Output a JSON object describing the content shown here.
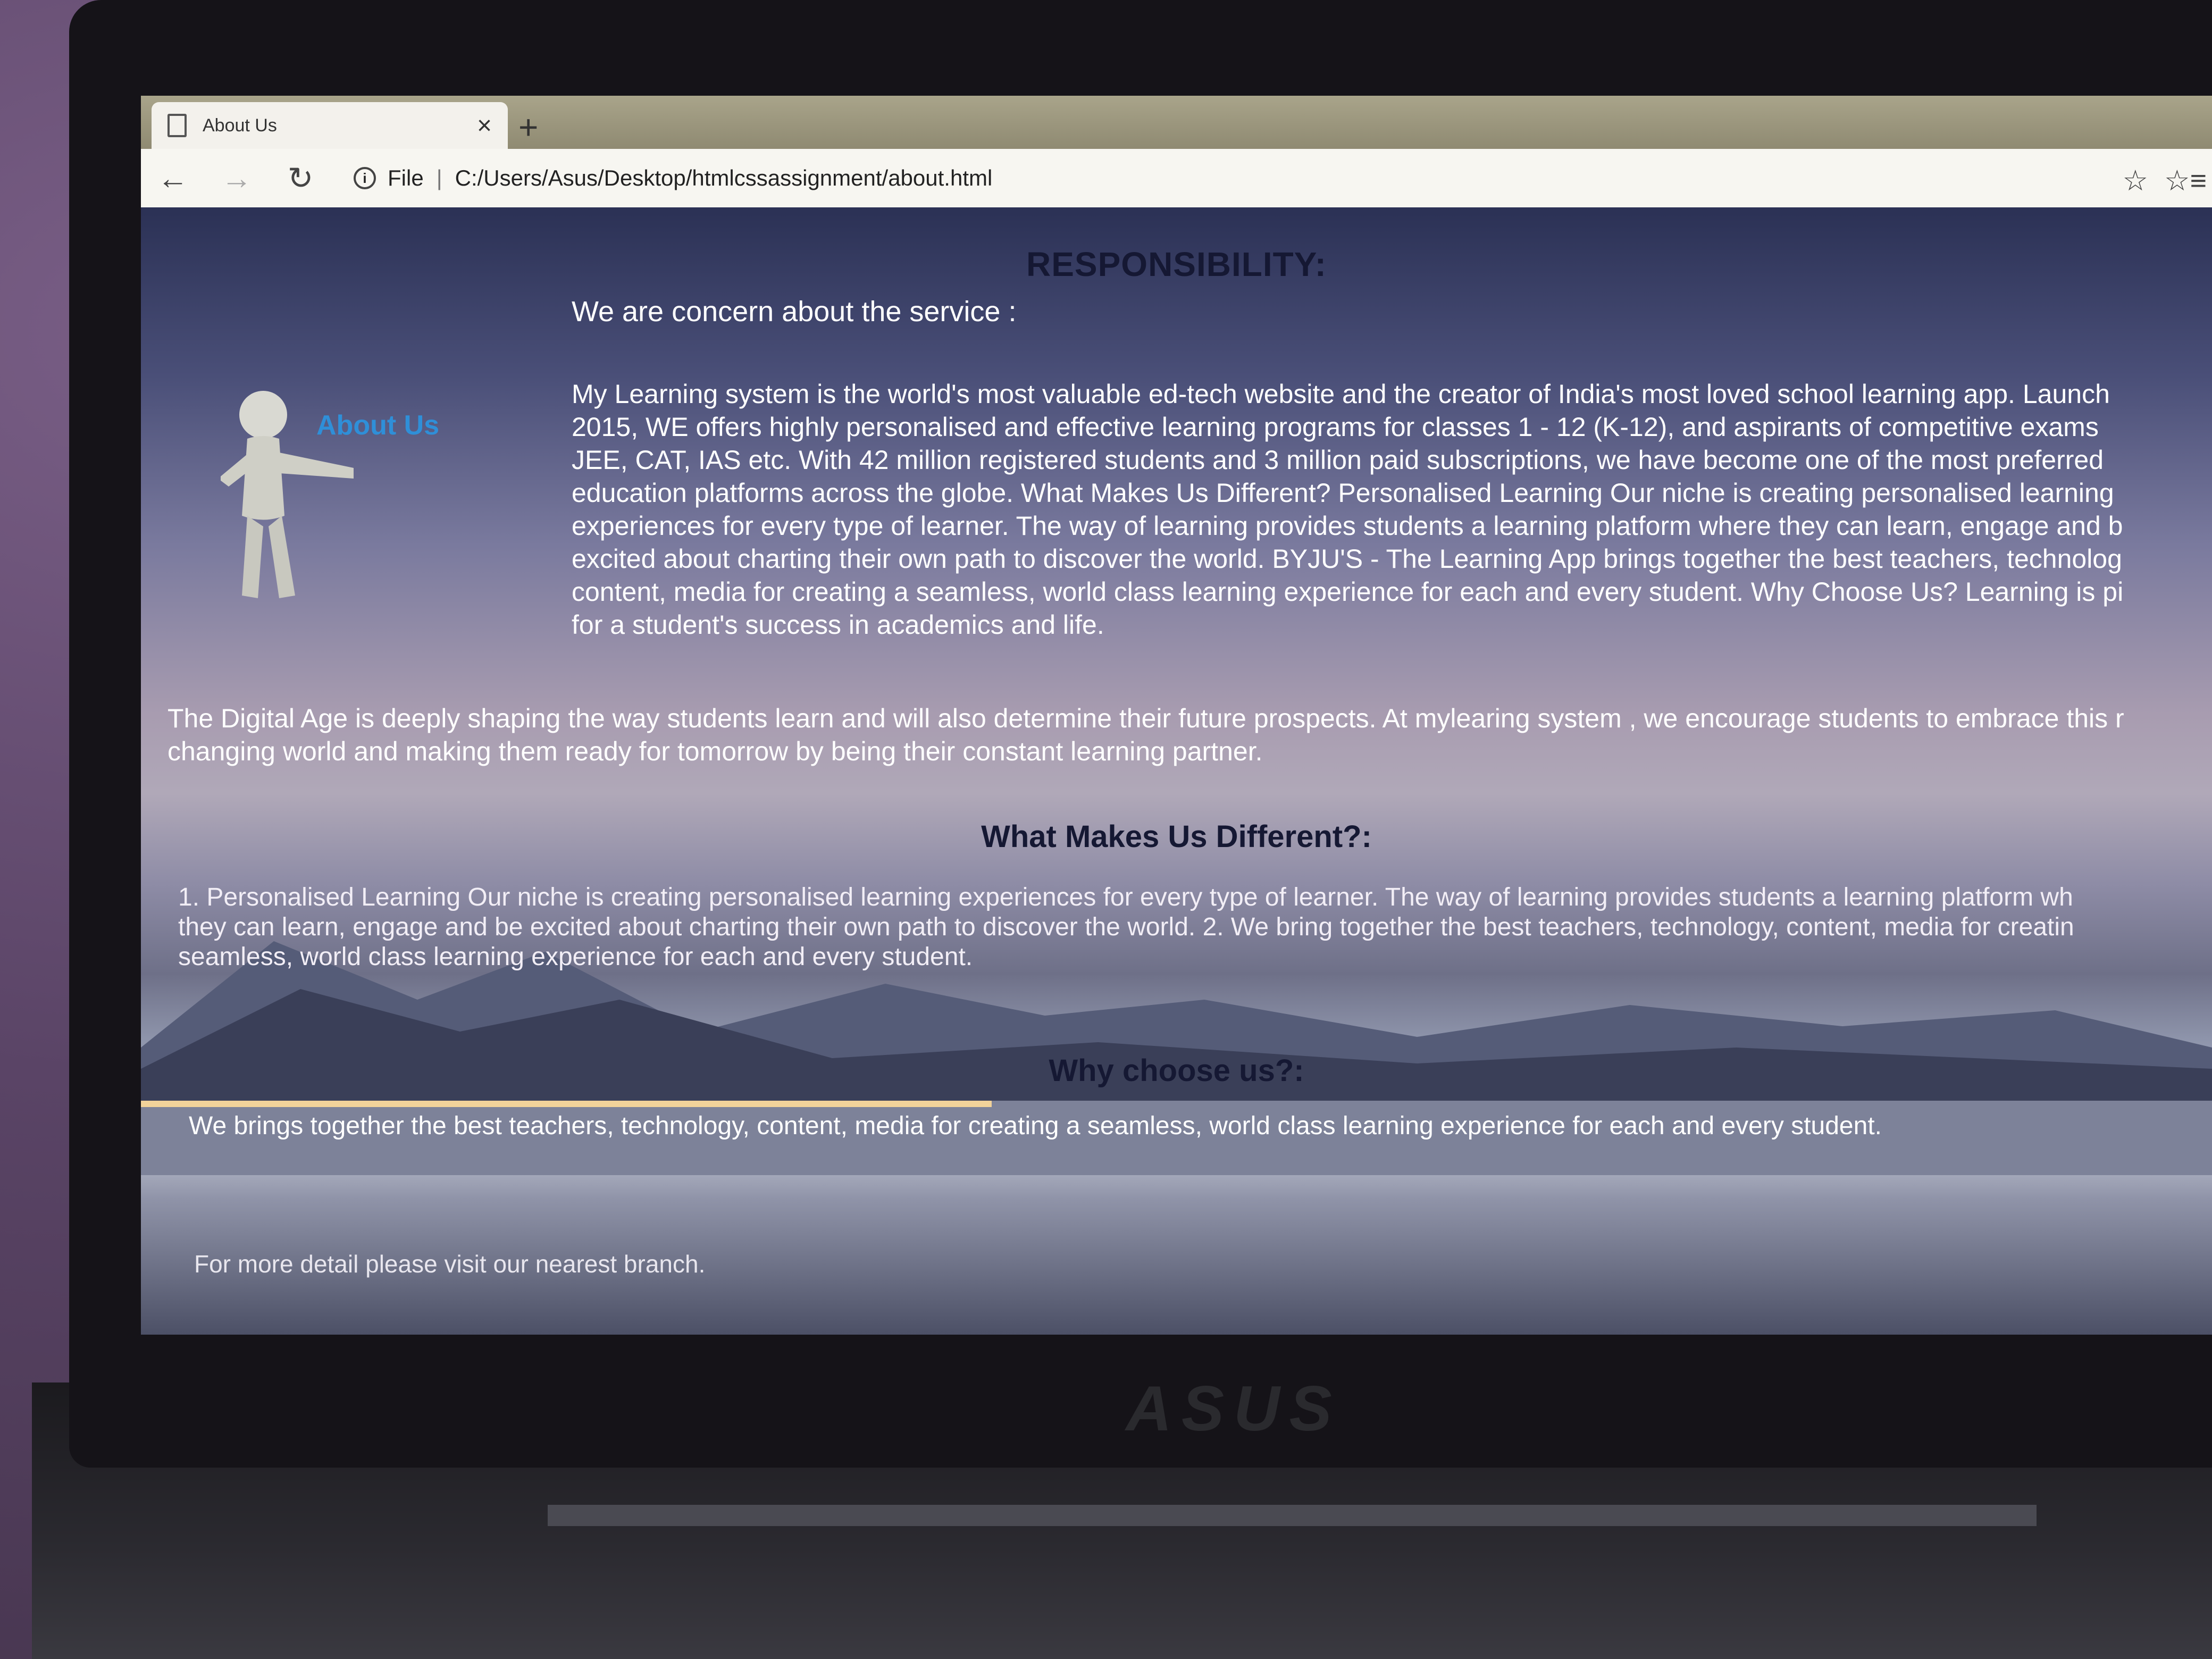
{
  "browser": {
    "tab_title": "About Us",
    "tab_close": "×",
    "new_tab": "+",
    "nav": {
      "back": "←",
      "forward": "→",
      "reload": "↻"
    },
    "address": {
      "info": "i",
      "scheme_label": "File",
      "separator": "|",
      "url": "C:/Users/Asus/Desktop/htmlcssassignment/about.html"
    },
    "bookmark_star": "☆",
    "favorites_icon": "☆≡"
  },
  "page": {
    "heading_responsibility": "RESPONSIBILITY:",
    "concern_line": "We are concern about the service :",
    "about_us_label": "About Us",
    "para1_lines": [
      "My Learning system is the world's most valuable ed-tech website and the creator of India's most loved school learning app. Launch",
      "2015, WE offers highly personalised and effective learning programs for classes 1 - 12 (K-12), and aspirants of competitive exams",
      "JEE, CAT, IAS etc. With 42 million registered students and 3 million paid subscriptions, we have become one of the most preferred",
      "education platforms across the globe. What Makes Us Different? Personalised Learning Our niche is creating personalised learning",
      "experiences for every type of learner. The way of learning provides students a learning platform where they can learn, engage and b",
      "excited about charting their own path to discover the world. BYJU'S - The Learning App brings together the best teachers, technolog",
      "content, media for creating a seamless, world class learning experience for each and every student. Why Choose Us? Learning is pi",
      "for a student's success in academics and life."
    ],
    "para2_lines": [
      "The Digital Age is deeply shaping the way students learn and will also determine their future prospects. At mylearing system , we encourage students to embrace this r",
      "changing world and making them ready for tomorrow by being their constant learning partner."
    ],
    "heading_different": "What Makes Us Different?:",
    "para3_lines": [
      "1. Personalised Learning Our niche is creating personalised learning experiences for every type of learner. The way of learning provides students a learning platform wh",
      "they can learn, engage and be excited about charting their own path to discover the world. 2. We bring together the best teachers, technology, content, media for creatin",
      "seamless, world class learning experience for each and every student."
    ],
    "heading_why": "Why choose us?:",
    "para4": "We brings together the best teachers, technology, content, media for creating a seamless, world class learning experience for each and every student.",
    "footer_note": "For more detail please visit our nearest branch."
  },
  "device": {
    "brand": "ASUS"
  },
  "colors": {
    "heading": "#151833",
    "about_us_accent": "#2f8fd8",
    "tab_bar": "#9e997f"
  }
}
